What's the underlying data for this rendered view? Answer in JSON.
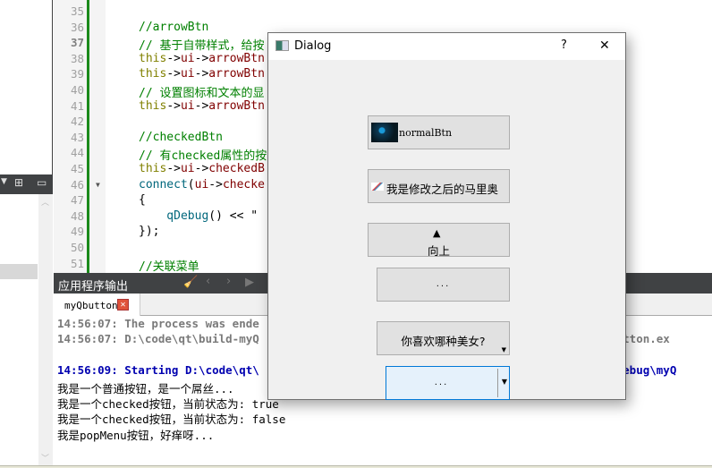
{
  "editor": {
    "line_numbers": [
      "35",
      "36",
      "37",
      "38",
      "39",
      "40",
      "41",
      "42",
      "43",
      "44",
      "45",
      "46",
      "47",
      "48",
      "49",
      "50",
      "51"
    ],
    "lines": [
      {
        "segments": []
      },
      {
        "segments": [
          {
            "t": "//arrowBtn",
            "c": "c"
          }
        ]
      },
      {
        "segments": [
          {
            "t": "// 基于自带样式，给按",
            "c": "c"
          }
        ]
      },
      {
        "segments": [
          {
            "t": "this",
            "c": "k"
          },
          {
            "t": "->",
            "c": ""
          },
          {
            "t": "ui",
            "c": "m"
          },
          {
            "t": "->",
            "c": ""
          },
          {
            "t": "arrowBtn",
            "c": "m"
          }
        ]
      },
      {
        "segments": [
          {
            "t": "this",
            "c": "k"
          },
          {
            "t": "->",
            "c": ""
          },
          {
            "t": "ui",
            "c": "m"
          },
          {
            "t": "->",
            "c": ""
          },
          {
            "t": "arrowBtn",
            "c": "m"
          }
        ]
      },
      {
        "segments": [
          {
            "t": "// 设置图标和文本的显",
            "c": "c"
          }
        ]
      },
      {
        "segments": [
          {
            "t": "this",
            "c": "k"
          },
          {
            "t": "->",
            "c": ""
          },
          {
            "t": "ui",
            "c": "m"
          },
          {
            "t": "->",
            "c": ""
          },
          {
            "t": "arrowBtn",
            "c": "m"
          }
        ]
      },
      {
        "segments": []
      },
      {
        "segments": [
          {
            "t": "//checkedBtn",
            "c": "c"
          }
        ]
      },
      {
        "segments": [
          {
            "t": "// 有checked属性的按",
            "c": "c"
          }
        ]
      },
      {
        "segments": [
          {
            "t": "this",
            "c": "k"
          },
          {
            "t": "->",
            "c": ""
          },
          {
            "t": "ui",
            "c": "m"
          },
          {
            "t": "->",
            "c": ""
          },
          {
            "t": "checkedB",
            "c": "m"
          }
        ]
      },
      {
        "segments": [
          {
            "t": "connect",
            "c": "f"
          },
          {
            "t": "(",
            "c": ""
          },
          {
            "t": "ui",
            "c": "m"
          },
          {
            "t": "->",
            "c": ""
          },
          {
            "t": "checke",
            "c": "m"
          }
        ]
      },
      {
        "segments": [
          {
            "t": "{",
            "c": ""
          }
        ]
      },
      {
        "segments": [
          {
            "t": "    qDebug",
            "c": "f"
          },
          {
            "t": "() << \"",
            "c": ""
          }
        ]
      },
      {
        "segments": [
          {
            "t": "});",
            "c": ""
          }
        ]
      },
      {
        "segments": []
      },
      {
        "segments": [
          {
            "t": "//关联菜单",
            "c": "c"
          }
        ]
      }
    ]
  },
  "output": {
    "title": "应用程序输出",
    "tab": "myQbutton",
    "lines": [
      {
        "text": "14:56:07: The process was ende",
        "cls": "gray"
      },
      {
        "text": "14:56:07: D:\\code\\qt\\build-myQ                                                \\myQbutton.ex",
        "cls": "gray"
      },
      {
        "text": "",
        "cls": ""
      },
      {
        "text": "14:56:09: Starting D:\\code\\qt\\                                                 bug\\debug\\myQ",
        "cls": "blue"
      },
      {
        "text": "我是一个普通按钮，是一个屌丝...",
        "cls": ""
      },
      {
        "text": "我是一个checked按钮，当前状态为: true",
        "cls": ""
      },
      {
        "text": "我是一个checked按钮，当前状态为: false",
        "cls": ""
      },
      {
        "text": "我是popMenu按钮，好痒呀...",
        "cls": ""
      }
    ]
  },
  "dialog": {
    "title": "Dialog",
    "help": "?",
    "close": "✕",
    "normal_btn": "normalBtn",
    "mario_btn": "我是修改之后的马里奥",
    "arrow_btn": "向上",
    "tool_btn": "...",
    "menu_btn": "你喜欢哪种美女?",
    "split_btn": "...",
    "accent": "#0078d7"
  }
}
